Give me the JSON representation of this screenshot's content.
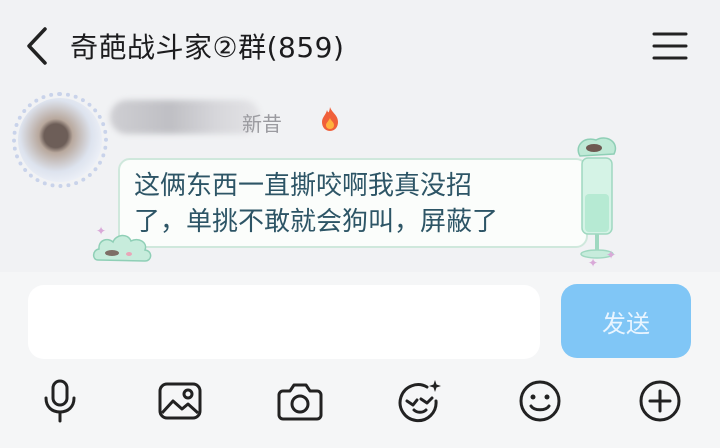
{
  "header": {
    "title": "奇葩战斗家②群(859)",
    "back_icon": "chevron-left-icon",
    "menu_icon": "hamburger-menu-icon"
  },
  "message": {
    "sender_name_visible": "新昔",
    "sender_badge_icon": "fire-icon",
    "text_lines": [
      "这俩东西一直撕咬啊我真没招",
      "了，单挑不敢就会狗叫，屏蔽了"
    ]
  },
  "input": {
    "value": "",
    "placeholder": "",
    "send_label": "发送"
  },
  "toolbar": {
    "icons": [
      "microphone-icon",
      "image-icon",
      "camera-icon",
      "magic-face-icon",
      "emoji-icon",
      "plus-icon"
    ]
  },
  "colors": {
    "background": "#f1f2f4",
    "bubble_border": "#cfe8dc",
    "bubble_text": "#2d5566",
    "send_button": "#80c6f6",
    "icon": "#222222"
  }
}
